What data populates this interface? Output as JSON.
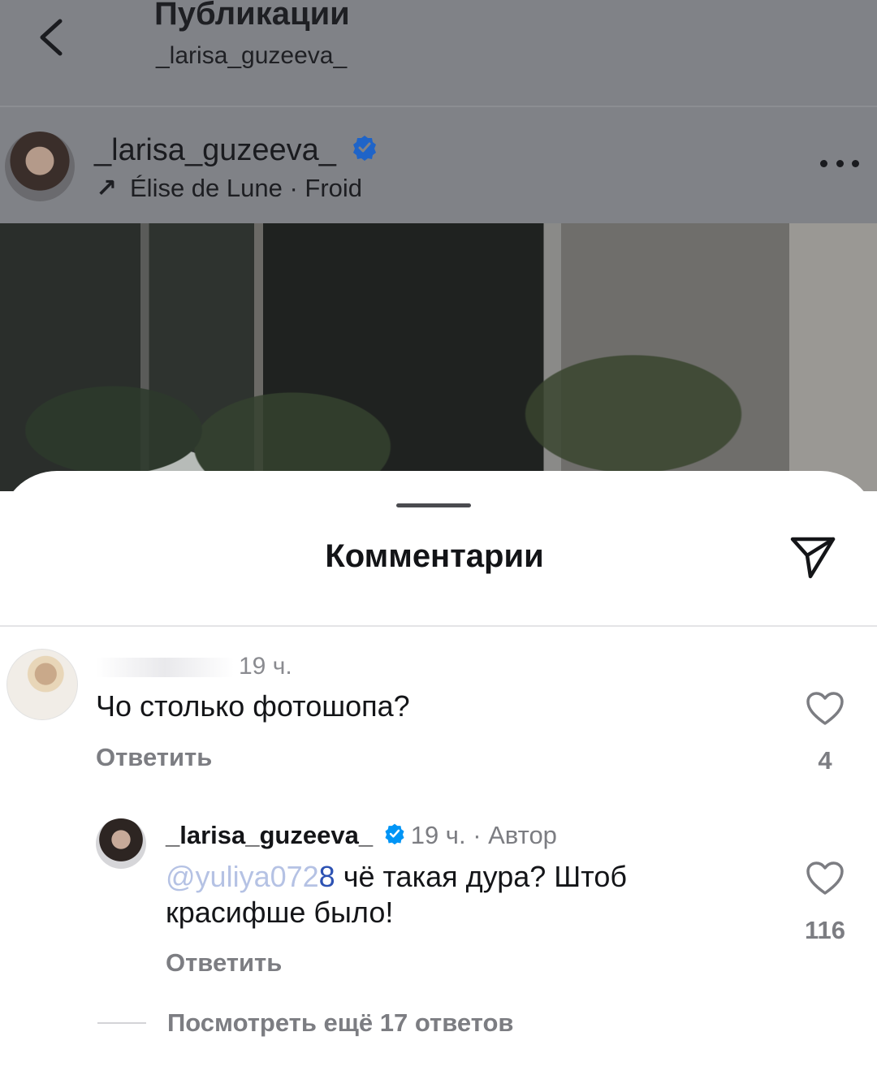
{
  "header": {
    "title": "Публикации",
    "subtitle": "_larisa_guzeeva_"
  },
  "post": {
    "username": "_larisa_guzeeva_",
    "audio": "Élise de Lune · Froid"
  },
  "comments_sheet": {
    "title": "Комментарии"
  },
  "comments": [
    {
      "time": "19 ч.",
      "text": "Чо столько фотошопа?",
      "reply_label": "Ответить",
      "likes": "4"
    },
    {
      "username": "_larisa_guzeeva_",
      "time": "19 ч.",
      "author_label": "· Автор",
      "mention_partial": "@yuliya072",
      "mention_end": "8",
      "text": " чё такая дура? Штоб красифше было!",
      "reply_label": "Ответить",
      "likes": "116"
    }
  ],
  "more_replies": "Посмотреть ещё 17 ответов",
  "colors": {
    "dim_overlay": "#808287",
    "verified_blue": "#0095f6",
    "secondary_text": "#7c7d82"
  }
}
